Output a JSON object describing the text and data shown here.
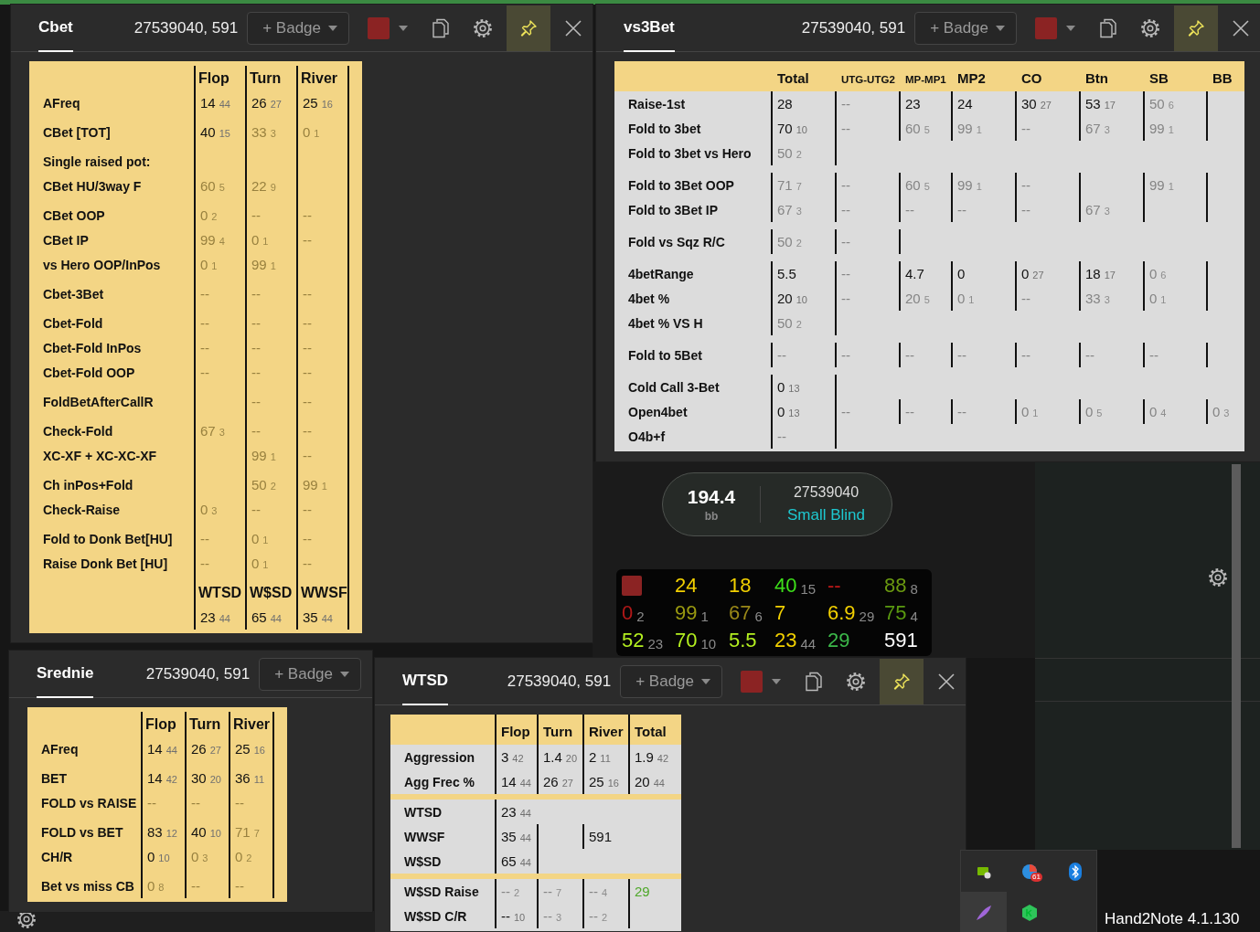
{
  "panels": [
    {
      "title": "Cbet",
      "player_id": "27539040, 591",
      "badge": "+ Badge",
      "color": "#8b2323",
      "pinned": true,
      "table": {
        "kind": "sheet",
        "sections": [
          [
            {
              "kind": "head",
              "cells": [
                "Flop",
                "Turn",
                "River"
              ]
            },
            {
              "kind": "stat",
              "label": "AFreq",
              "cells": [
                {
                  "v": "14",
                  "n": "44",
                  "faded": false
                },
                {
                  "v": "26",
                  "n": "27",
                  "faded": false
                },
                {
                  "v": "25",
                  "n": "16",
                  "faded": false
                }
              ]
            }
          ],
          [
            {
              "kind": "stat",
              "label": "CBet [TOT]",
              "cells": [
                {
                  "v": "40",
                  "n": "15",
                  "faded": false
                },
                {
                  "v": "33",
                  "n": "3",
                  "faded": true
                },
                {
                  "v": "0",
                  "n": "1",
                  "faded": true
                }
              ]
            }
          ],
          [
            {
              "kind": "stat",
              "label": "Single raised pot:",
              "cells": [
                {},
                {},
                {}
              ]
            },
            {
              "kind": "stat",
              "label": "CBet HU/3way F",
              "cells": [
                {
                  "v": "60",
                  "n": "5",
                  "faded": true
                },
                {
                  "v": "22",
                  "n": "9",
                  "faded": true
                },
                {}
              ]
            }
          ],
          [
            {
              "kind": "stat",
              "label": "CBet OOP",
              "cells": [
                {
                  "v": "0",
                  "n": "2",
                  "faded": true
                },
                {
                  "v": "--",
                  "faded": true
                },
                {
                  "v": "--",
                  "faded": true
                }
              ]
            },
            {
              "kind": "stat",
              "label": "CBet IP",
              "cells": [
                {
                  "v": "99",
                  "n": "4",
                  "faded": true
                },
                {
                  "v": "0",
                  "n": "1",
                  "faded": true
                },
                {
                  "v": "--",
                  "faded": true
                }
              ]
            },
            {
              "kind": "stat",
              "label": "vs Hero OOP/InPos",
              "cells": [
                {
                  "v": "0",
                  "n": "1",
                  "faded": true
                },
                {
                  "v": "99",
                  "n": "1",
                  "faded": true
                },
                {}
              ]
            }
          ],
          [
            {
              "kind": "stat",
              "label": "Cbet-3Bet",
              "cells": [
                {
                  "v": "--",
                  "faded": true
                },
                {
                  "v": "--",
                  "faded": true
                },
                {
                  "v": "--",
                  "faded": true
                }
              ]
            }
          ],
          [
            {
              "kind": "stat",
              "label": "Cbet-Fold",
              "cells": [
                {
                  "v": "--",
                  "faded": true
                },
                {
                  "v": "--",
                  "faded": true
                },
                {
                  "v": "--",
                  "faded": true
                }
              ]
            },
            {
              "kind": "stat",
              "label": "Cbet-Fold InPos",
              "cells": [
                {
                  "v": "--",
                  "faded": true
                },
                {
                  "v": "--",
                  "faded": true
                },
                {
                  "v": "--",
                  "faded": true
                }
              ]
            },
            {
              "kind": "stat",
              "label": "Cbet-Fold OOP",
              "cells": [
                {
                  "v": "--",
                  "faded": true
                },
                {
                  "v": "--",
                  "faded": true
                },
                {
                  "v": "--",
                  "faded": true
                }
              ]
            }
          ],
          [
            {
              "kind": "stat",
              "label": "FoldBetAfterCallR",
              "cells": [
                {},
                {
                  "v": "--",
                  "faded": true
                },
                {
                  "v": "--",
                  "faded": true
                }
              ]
            }
          ],
          [
            {
              "kind": "stat",
              "label": "Check-Fold",
              "cells": [
                {
                  "v": "67",
                  "n": "3",
                  "faded": true
                },
                {
                  "v": "--",
                  "faded": true
                },
                {
                  "v": "--",
                  "faded": true
                }
              ]
            },
            {
              "kind": "stat",
              "label": "XC-XF + XC-XC-XF",
              "cells": [
                {},
                {
                  "v": "99",
                  "n": "1",
                  "faded": true
                },
                {
                  "v": "--",
                  "faded": true
                }
              ]
            }
          ],
          [
            {
              "kind": "stat",
              "label": "Ch inPos+Fold",
              "cells": [
                {},
                {
                  "v": "50",
                  "n": "2",
                  "faded": true
                },
                {
                  "v": "99",
                  "n": "1",
                  "faded": true
                }
              ]
            },
            {
              "kind": "stat",
              "label": "Check-Raise",
              "cells": [
                {
                  "v": "0",
                  "n": "3",
                  "faded": true
                },
                {
                  "v": "--",
                  "faded": true
                },
                {
                  "v": "--",
                  "faded": true
                }
              ]
            }
          ],
          [
            {
              "kind": "stat",
              "label": "Fold to Donk Bet[HU]",
              "cells": [
                {
                  "v": "--",
                  "faded": true
                },
                {
                  "v": "0",
                  "n": "1",
                  "faded": true
                },
                {
                  "v": "--",
                  "faded": true
                }
              ]
            },
            {
              "kind": "stat",
              "label": "Raise Donk Bet [HU]",
              "cells": [
                {
                  "v": "--",
                  "faded": true
                },
                {
                  "v": "0",
                  "n": "1",
                  "faded": true
                },
                {
                  "v": "--",
                  "faded": true
                }
              ]
            }
          ],
          [
            {
              "kind": "head",
              "cells": [
                "WTSD",
                "W$SD",
                "WWSF"
              ]
            },
            {
              "kind": "stat",
              "cells": [
                {
                  "v": "23",
                  "n": "44",
                  "faded": false
                },
                {
                  "v": "65",
                  "n": "44",
                  "faded": false
                },
                {
                  "v": "35",
                  "n": "44",
                  "faded": false
                }
              ]
            }
          ]
        ]
      }
    },
    {
      "title": "vs3Bet",
      "player_id": "27539040, 591",
      "badge": "+ Badge",
      "color": "#8b2323",
      "pinned": true,
      "table": {
        "kind": "matrix",
        "sections": [
          [
            {
              "kind": "head",
              "cells": [
                "Total",
                "UTG-UTG2",
                "MP-MP1",
                "MP2",
                "CO",
                "Btn",
                "SB",
                "BB"
              ]
            },
            {
              "kind": "stat",
              "label": "Raise-1st",
              "cells": [
                {
                  "v": "28",
                  "faded": false
                },
                {
                  "v": "--",
                  "faded": true
                },
                {
                  "v": "23",
                  "faded": false
                },
                {
                  "v": "24",
                  "faded": false
                },
                {
                  "v": "30",
                  "n": "27",
                  "faded": false
                },
                {
                  "v": "53",
                  "n": "17",
                  "faded": false
                },
                {
                  "v": "50",
                  "n": "6",
                  "faded": true
                },
                {}
              ]
            },
            {
              "kind": "stat",
              "label": "Fold to 3bet",
              "cells": [
                {
                  "v": "70",
                  "n": "10",
                  "faded": false
                },
                {
                  "v": "--",
                  "faded": true
                },
                {
                  "v": "60",
                  "n": "5",
                  "faded": true
                },
                {
                  "v": "99",
                  "n": "1",
                  "faded": true
                },
                {
                  "v": "--",
                  "faded": true
                },
                {
                  "v": "67",
                  "n": "3",
                  "faded": true
                },
                {
                  "v": "99",
                  "n": "1",
                  "faded": true
                },
                {}
              ]
            },
            {
              "kind": "stat",
              "label": "Fold to 3bet vs Hero",
              "cells": [
                {
                  "v": "50",
                  "n": "2",
                  "faded": true
                },
                {},
                null,
                null,
                null,
                null,
                null,
                null
              ]
            }
          ],
          [
            {
              "kind": "stat",
              "label": "Fold to 3Bet OOP",
              "cells": [
                {
                  "v": "71",
                  "n": "7",
                  "faded": true
                },
                {
                  "v": "--",
                  "faded": true
                },
                {
                  "v": "60",
                  "n": "5",
                  "faded": true
                },
                {
                  "v": "99",
                  "n": "1",
                  "faded": true
                },
                {
                  "v": "--",
                  "faded": true
                },
                {},
                {
                  "v": "99",
                  "n": "1",
                  "faded": true
                },
                {}
              ]
            },
            {
              "kind": "stat",
              "label": "Fold to 3Bet IP",
              "cells": [
                {
                  "v": "67",
                  "n": "3",
                  "faded": true
                },
                {
                  "v": "--",
                  "faded": true
                },
                {
                  "v": "--",
                  "faded": true
                },
                {
                  "v": "--",
                  "faded": true
                },
                {
                  "v": "--",
                  "faded": true
                },
                {
                  "v": "67",
                  "n": "3",
                  "faded": true
                },
                {},
                {}
              ]
            }
          ],
          [
            {
              "kind": "stat",
              "label": "Fold vs Sqz R/C",
              "cells": [
                {
                  "v": "50",
                  "n": "2",
                  "faded": true
                },
                {
                  "v": "--",
                  "faded": true
                },
                {},
                null,
                null,
                null,
                null,
                null
              ]
            }
          ],
          [
            {
              "kind": "stat",
              "label": "4betRange",
              "cells": [
                {
                  "v": "5.5",
                  "faded": false
                },
                {
                  "v": "--",
                  "faded": true
                },
                {
                  "v": "4.7",
                  "faded": false
                },
                {
                  "v": "0",
                  "faded": false
                },
                {
                  "v": "0",
                  "n": "27",
                  "faded": false
                },
                {
                  "v": "18",
                  "n": "17",
                  "faded": false
                },
                {
                  "v": "0",
                  "n": "6",
                  "faded": true
                },
                {}
              ]
            },
            {
              "kind": "stat",
              "label": "4bet %",
              "cells": [
                {
                  "v": "20",
                  "n": "10",
                  "faded": false
                },
                {
                  "v": "--",
                  "faded": true
                },
                {
                  "v": "20",
                  "n": "5",
                  "faded": true
                },
                {
                  "v": "0",
                  "n": "1",
                  "faded": true
                },
                {
                  "v": "--",
                  "faded": true
                },
                {
                  "v": "33",
                  "n": "3",
                  "faded": true
                },
                {
                  "v": "0",
                  "n": "1",
                  "faded": true
                },
                {}
              ]
            },
            {
              "kind": "stat",
              "label": "4bet % VS H",
              "cells": [
                {
                  "v": "50",
                  "n": "2",
                  "faded": true
                },
                {},
                null,
                null,
                null,
                null,
                null,
                null
              ]
            }
          ],
          [
            {
              "kind": "stat",
              "label": "Fold to 5Bet",
              "cells": [
                {
                  "v": "--",
                  "faded": true
                },
                {
                  "v": "--",
                  "faded": true
                },
                {
                  "v": "--",
                  "faded": true
                },
                {
                  "v": "--",
                  "faded": true
                },
                {
                  "v": "--",
                  "faded": true
                },
                {
                  "v": "--",
                  "faded": true
                },
                {
                  "v": "--",
                  "faded": true
                },
                {}
              ]
            }
          ],
          [
            {
              "kind": "stat",
              "label": "Cold Call 3-Bet",
              "cells": [
                {
                  "v": "0",
                  "n": "13",
                  "faded": false
                },
                {},
                null,
                null,
                null,
                null,
                null,
                null
              ]
            },
            {
              "kind": "stat",
              "label": "Open4bet",
              "cells": [
                {
                  "v": "0",
                  "n": "13",
                  "faded": false
                },
                {
                  "v": "--",
                  "faded": true
                },
                {
                  "v": "--",
                  "faded": true
                },
                {
                  "v": "--",
                  "faded": true
                },
                {
                  "v": "0",
                  "n": "1",
                  "faded": true
                },
                {
                  "v": "0",
                  "n": "5",
                  "faded": true
                },
                {
                  "v": "0",
                  "n": "4",
                  "faded": true
                },
                {
                  "v": "0",
                  "n": "3",
                  "faded": true
                }
              ]
            },
            {
              "kind": "stat",
              "label": "O4b+f",
              "cells": [
                {
                  "v": "--",
                  "faded": true
                },
                {},
                null,
                null,
                null,
                null,
                null,
                null
              ]
            }
          ]
        ]
      }
    },
    {
      "title": "Srednie",
      "player_id": "27539040, 591",
      "badge": "+ Badge",
      "table": {
        "kind": "sheet",
        "sections": [
          [
            {
              "kind": "head",
              "cells": [
                "Flop",
                "Turn",
                "River"
              ]
            },
            {
              "kind": "stat",
              "label": "AFreq",
              "cells": [
                {
                  "v": "14",
                  "n": "44",
                  "faded": false
                },
                {
                  "v": "26",
                  "n": "27",
                  "faded": false
                },
                {
                  "v": "25",
                  "n": "16",
                  "faded": false
                }
              ]
            }
          ],
          [
            {
              "kind": "stat",
              "label": "BET",
              "cells": [
                {
                  "v": "14",
                  "n": "42",
                  "faded": false
                },
                {
                  "v": "30",
                  "n": "20",
                  "faded": false
                },
                {
                  "v": "36",
                  "n": "11",
                  "faded": false
                }
              ]
            },
            {
              "kind": "stat",
              "label": "FOLD vs RAISE",
              "cells": [
                {
                  "v": "--",
                  "faded": true
                },
                {
                  "v": "--",
                  "faded": true
                },
                {
                  "v": "--",
                  "faded": true
                }
              ]
            }
          ],
          [
            {
              "kind": "stat",
              "label": "FOLD vs BET",
              "cells": [
                {
                  "v": "83",
                  "n": "12",
                  "faded": false
                },
                {
                  "v": "40",
                  "n": "10",
                  "faded": false
                },
                {
                  "v": "71",
                  "n": "7",
                  "faded": true
                }
              ]
            },
            {
              "kind": "stat",
              "label": "CH/R",
              "cells": [
                {
                  "v": "0",
                  "n": "10",
                  "faded": false
                },
                {
                  "v": "0",
                  "n": "3",
                  "faded": true
                },
                {
                  "v": "0",
                  "n": "2",
                  "faded": true
                }
              ]
            }
          ],
          [
            {
              "kind": "stat",
              "label": "Bet vs miss CB",
              "cells": [
                {
                  "v": "0",
                  "n": "8",
                  "faded": true
                },
                {
                  "v": "--",
                  "faded": true
                },
                {
                  "v": "--",
                  "faded": true
                }
              ]
            }
          ]
        ]
      }
    },
    {
      "title": "WTSD",
      "player_id": "27539040, 591",
      "badge": "+ Badge",
      "color": "#8b2323",
      "pinned": true,
      "table": {
        "kind": "grid",
        "sections": [
          [
            {
              "kind": "head",
              "cells": [
                "Flop",
                "Turn",
                "River",
                "Total"
              ]
            },
            {
              "kind": "stat",
              "label": "Aggression",
              "cells": [
                {
                  "v": "3",
                  "n": "42",
                  "faded": false
                },
                {
                  "v": "1.4",
                  "n": "20",
                  "faded": false
                },
                {
                  "v": "2",
                  "n": "11",
                  "faded": false
                },
                {
                  "v": "1.9",
                  "n": "42",
                  "faded": false
                }
              ]
            },
            {
              "kind": "stat",
              "label": "Agg Frec %",
              "cells": [
                {
                  "v": "14",
                  "n": "44",
                  "faded": false
                },
                {
                  "v": "26",
                  "n": "27",
                  "faded": false
                },
                {
                  "v": "25",
                  "n": "16",
                  "faded": false
                },
                {
                  "v": "20",
                  "n": "44",
                  "faded": false
                }
              ]
            }
          ],
          [
            {
              "kind": "stat",
              "label": "WTSD",
              "cells": [
                {
                  "v": "23",
                  "n": "44",
                  "faded": false
                },
                null,
                null,
                null
              ]
            },
            {
              "kind": "stat",
              "label": "WWSF",
              "cells": [
                {
                  "v": "35",
                  "n": "44",
                  "faded": false
                },
                {},
                {
                  "v": "591",
                  "faded": false
                },
                null
              ]
            },
            {
              "kind": "stat",
              "label": "W$SD",
              "cells": [
                {
                  "v": "65",
                  "n": "44",
                  "faded": false
                },
                {},
                null,
                null
              ]
            }
          ],
          [
            {
              "kind": "stat",
              "label": "W$SD Raise",
              "cells": [
                {
                  "v": "--",
                  "n": "2",
                  "faded": true
                },
                {
                  "v": "--",
                  "n": "7",
                  "faded": true
                },
                {
                  "v": "--",
                  "n": "4",
                  "faded": true
                },
                {
                  "v": "29",
                  "faded": true,
                  "color": "#4fa82a"
                }
              ]
            },
            {
              "kind": "stat",
              "label": "W$SD C/R",
              "cells": [
                {
                  "v": "--",
                  "n": "10",
                  "faded": false
                },
                {
                  "v": "--",
                  "n": "3",
                  "faded": true
                },
                {
                  "v": "--",
                  "n": "2",
                  "faded": true
                },
                {}
              ]
            }
          ]
        ]
      }
    }
  ],
  "seat": {
    "stack": "194.4",
    "unit": "bb",
    "player": "27539040",
    "position": "Small Blind"
  },
  "hud": {
    "rows": [
      [
        {
          "kind": "swatch",
          "color": "#8b2323"
        },
        {
          "kind": "stat",
          "v": "24",
          "color": "#f2d000"
        },
        {
          "kind": "stat",
          "v": "18",
          "color": "#f2d000"
        },
        {
          "kind": "stat",
          "v": "40",
          "n": "15",
          "color": "#3ee01a"
        },
        {
          "kind": "stat",
          "v": "--",
          "color": "#c01818"
        },
        {
          "kind": "stat",
          "v": "88",
          "n": "8",
          "color": "#6b9a10"
        }
      ],
      [
        {
          "kind": "stat",
          "v": "0",
          "n": "2",
          "color": "#b01818"
        },
        {
          "kind": "stat",
          "v": "99",
          "n": "1",
          "color": "#9a9a10"
        },
        {
          "kind": "stat",
          "v": "67",
          "n": "6",
          "color": "#9a8818"
        },
        {
          "kind": "stat",
          "v": "7",
          "color": "#f2d000"
        },
        {
          "kind": "stat",
          "v": "6.9",
          "n": "29",
          "color": "#f2d000"
        },
        {
          "kind": "stat",
          "v": "75",
          "n": "4",
          "color": "#5a9a10"
        }
      ],
      [
        {
          "kind": "stat",
          "v": "52",
          "n": "23",
          "color": "#b4f020"
        },
        {
          "kind": "stat",
          "v": "70",
          "n": "10",
          "color": "#b4f020"
        },
        {
          "kind": "stat",
          "v": "5.5",
          "color": "#b4f020"
        },
        {
          "kind": "stat",
          "v": "23",
          "n": "44",
          "color": "#f2d000"
        },
        {
          "kind": "stat",
          "v": "29",
          "color": "#3cb84a"
        },
        {
          "kind": "stat",
          "v": "591",
          "color": "#ffffff"
        }
      ]
    ]
  },
  "tray": {
    "badge": "61"
  },
  "app_version": "Hand2Note 4.1.130"
}
